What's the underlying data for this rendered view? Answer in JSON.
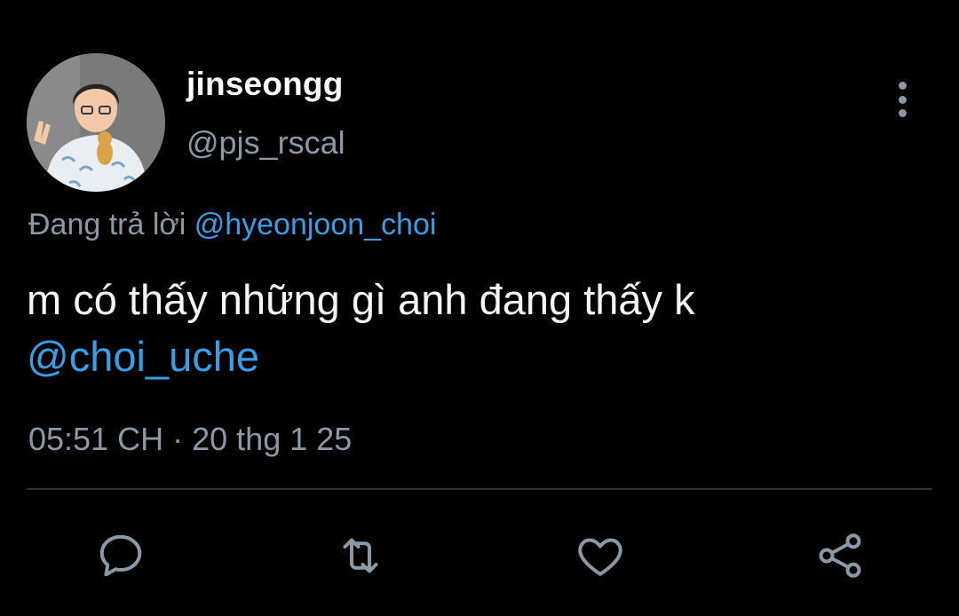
{
  "tweet": {
    "author": {
      "display_name": "jinseongg",
      "handle": "@pjs_rscal"
    },
    "reply_prefix": "Đang trả lời",
    "reply_to": "@hyeonjoon_choi",
    "text_line1": "m có thấy những gì anh đang thấy k",
    "text_mention": "@choi_uche",
    "time": "05:51 CH",
    "separator": "·",
    "date": "20 thg 1 25"
  },
  "icons": {
    "more": "more-vertical-icon",
    "reply": "comment-icon",
    "retweet": "retweet-icon",
    "like": "heart-icon",
    "share": "share-icon"
  },
  "colors": {
    "background": "#000000",
    "text": "#f5f5f5",
    "secondary": "#8b98a5",
    "link": "#3a9ee4",
    "divider": "#2f3336"
  }
}
